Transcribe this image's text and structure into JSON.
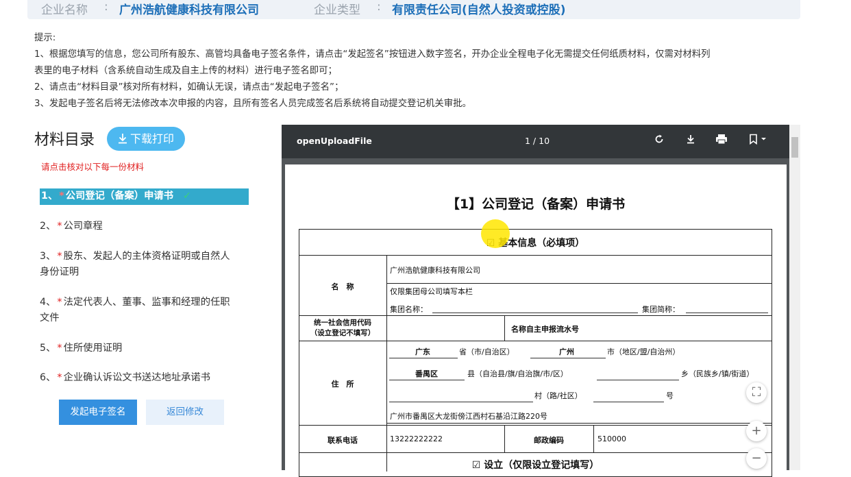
{
  "company_bar": {
    "name_label": "企业名称",
    "name_value": "广州浩航健康科技有限公司",
    "type_label": "企业类型",
    "type_value": "有限责任公司(自然人投资或控股)",
    "colon": ":"
  },
  "notice": {
    "title": "提示:",
    "line1": "1、根据您填写的信息，您公司所有股东、高管均具备电子签名条件，请点击“发起签名”按钮进入数字签名，开办企业全程电子化无需提交任何纸质材料，仅需对材料列",
    "line1b": "表里的电子材料（含系统自动生成及自主上传的材料）进行电子签名即可；",
    "line2": "2、请点击“材料目录”核对所有材料，如确认无误，请点击“发起电子签名”；",
    "line3": "3、发起电子签名后将无法修改本次申报的内容，且所有签名人员完成签名后系统将自动提交登记机关审批。"
  },
  "materials": {
    "title": "材料目录",
    "download_label": "下载打印",
    "hint": "请点击核对以下每一份材料",
    "items": [
      {
        "num": "1、",
        "line1": "公司登记（备案）申请书",
        "line2": ""
      },
      {
        "num": "2、",
        "line1": "公司章程",
        "line2": ""
      },
      {
        "num": "3、",
        "line1": "股东、发起人的主体资格证明或自然人",
        "line2": "身份证明"
      },
      {
        "num": "4、",
        "line1": "法定代表人、董事、监事和经理的任职",
        "line2": "文件"
      },
      {
        "num": "5、",
        "line1": "住所使用证明",
        "line2": ""
      },
      {
        "num": "6、",
        "line1": "企业确认诉讼文书送达地址承诺书",
        "line2": ""
      }
    ],
    "star": "*",
    "check": "✓",
    "sign_button": "发起电子签名",
    "back_button": "返回修改"
  },
  "viewer": {
    "filename": "openUploadFile",
    "page_indicator": "1 / 10"
  },
  "document": {
    "title": "【1】公司登记（备案）申请书",
    "section1": "☑  基本信息（必填项）",
    "name_label": "名　称",
    "name_value": "广州浩航健康科技有限公司",
    "group_note": "仅限集团母公司填写本栏",
    "group_name": "集团名称：",
    "group_short": "集团简称：",
    "credit_code_l1": "统一社会信用代码",
    "credit_code_l2": "（设立登记不填写）",
    "self_report": "名称自主申报流水号",
    "address_label": "住　所",
    "prov": "广东",
    "prov_suffix": "省（市/自治区）",
    "city": "广州",
    "city_suffix": "市（地区/盟/自治州）",
    "county": "番禺区",
    "county_suffix": "县（自治县/旗/自治旗/市/区）",
    "town_suffix": "乡（民族乡/镇/街道）",
    "village_suffix": "村（路/社区）",
    "number_suffix": "号",
    "full_address": "广州市番禺区大龙街傍江西村石基沿江路220号",
    "phone_label": "联系电话",
    "phone_value": "13222222222",
    "postal_label": "邮政编码",
    "postal_value": "510000",
    "section2": "☑  设立（仅限设立登记填写）"
  },
  "zoom": {
    "fit": "⛶",
    "plus": "+",
    "minus": "−"
  }
}
